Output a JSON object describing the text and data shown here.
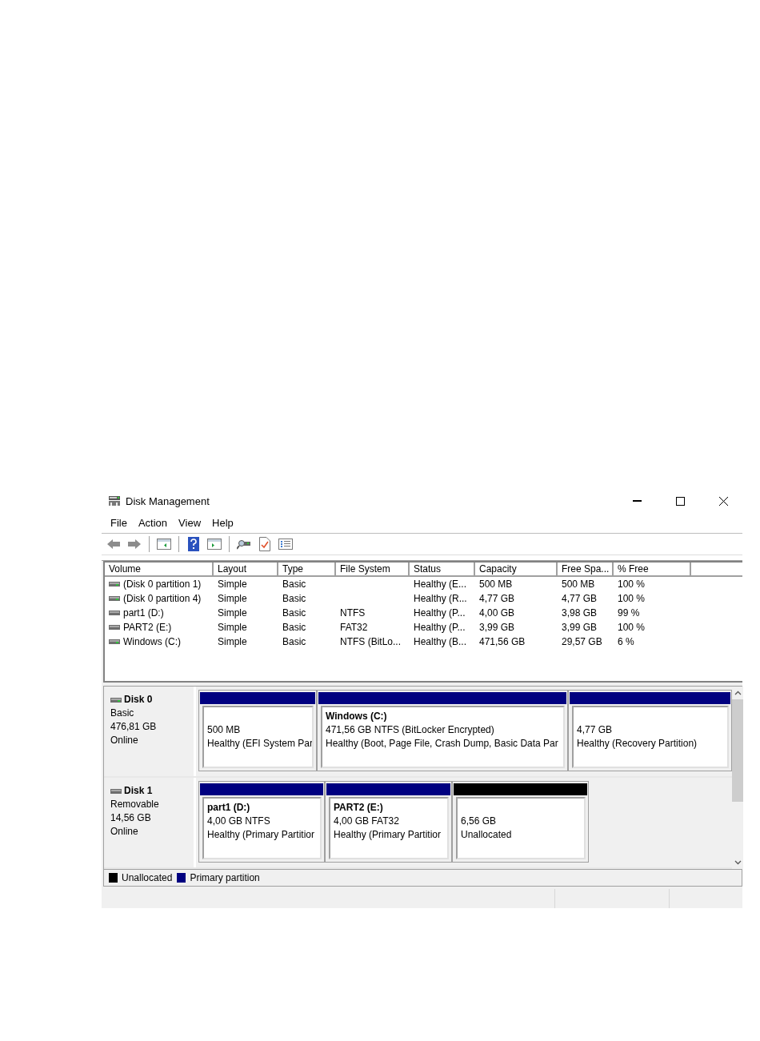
{
  "window": {
    "title": "Disk Management"
  },
  "menu": [
    "File",
    "Action",
    "View",
    "Help"
  ],
  "table": {
    "columns": [
      "Volume",
      "Layout",
      "Type",
      "File System",
      "Status",
      "Capacity",
      "Free Spa...",
      "% Free"
    ],
    "rows": [
      {
        "removable": false,
        "cells": [
          "(Disk 0 partition 1)",
          "Simple",
          "Basic",
          "",
          "Healthy (E...",
          "500 MB",
          "500 MB",
          "100 %"
        ]
      },
      {
        "removable": false,
        "cells": [
          "(Disk 0 partition 4)",
          "Simple",
          "Basic",
          "",
          "Healthy (R...",
          "4,77 GB",
          "4,77 GB",
          "100 %"
        ]
      },
      {
        "removable": true,
        "cells": [
          "part1 (D:)",
          "Simple",
          "Basic",
          "NTFS",
          "Healthy (P...",
          "4,00 GB",
          "3,98 GB",
          "99 %"
        ]
      },
      {
        "removable": true,
        "cells": [
          "PART2 (E:)",
          "Simple",
          "Basic",
          "FAT32",
          "Healthy (P...",
          "3,99 GB",
          "3,99 GB",
          "100 %"
        ]
      },
      {
        "removable": false,
        "cells": [
          "Windows (C:)",
          "Simple",
          "Basic",
          "NTFS (BitLo...",
          "Healthy (B...",
          "471,56 GB",
          "29,57 GB",
          "6 %"
        ]
      }
    ]
  },
  "disks": [
    {
      "name": "Disk 0",
      "removable": false,
      "type": "Basic",
      "size": "476,81 GB",
      "state": "Online",
      "partitions": [
        {
          "kind": "primary",
          "size": "500 MB",
          "status": "Healthy (EFI System Par"
        },
        {
          "kind": "primary",
          "label": "Windows  (C:)",
          "size": "471,56 GB NTFS (BitLocker Encrypted)",
          "status": "Healthy (Boot, Page File, Crash Dump, Basic Data Par"
        },
        {
          "kind": "primary",
          "size": "4,77 GB",
          "status": "Healthy (Recovery Partition)"
        }
      ]
    },
    {
      "name": "Disk 1",
      "removable": true,
      "type": "Removable",
      "size": "14,56 GB",
      "state": "Online",
      "partitions": [
        {
          "kind": "primary",
          "label": "part1  (D:)",
          "size": "4,00 GB NTFS",
          "status": "Healthy (Primary Partitior"
        },
        {
          "kind": "primary",
          "label": "PART2  (E:)",
          "size": "4,00 GB FAT32",
          "status": "Healthy (Primary Partitior"
        },
        {
          "kind": "unallocated",
          "size": "6,56 GB",
          "status": "Unallocated"
        }
      ]
    }
  ],
  "legend": [
    {
      "kind": "unallocated",
      "label": "Unallocated"
    },
    {
      "kind": "primary",
      "label": "Primary partition"
    }
  ]
}
